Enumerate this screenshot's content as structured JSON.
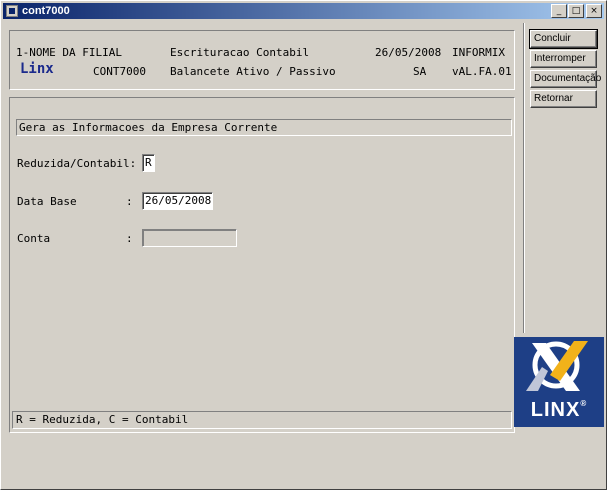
{
  "window": {
    "title": "cont7000"
  },
  "title_buttons": {
    "minimize": "_",
    "maximize": "□",
    "close": "×"
  },
  "header": {
    "row1": {
      "branch": "1-NOME DA FILIAL",
      "module": "Escrituracao Contabil",
      "date": "26/05/2008",
      "db": "INFORMIX"
    },
    "row2": {
      "logo": "Linx",
      "program": "CONT7000",
      "report": "Balancete Ativo / Passivo",
      "user": "SA",
      "version": "vAL.FA.01"
    }
  },
  "form": {
    "section_title": "Gera as Informacoes da Empresa Corrente",
    "fields": [
      {
        "label": "Reduzida/Contabil:",
        "value": "R"
      },
      {
        "label": "Data Base",
        "colon": ":",
        "value": "26/05/2008"
      },
      {
        "label": "Conta",
        "colon": ":",
        "value": ""
      }
    ],
    "status": "R = Reduzida, C = Contabil"
  },
  "side_buttons": [
    {
      "label": "Concluir"
    },
    {
      "label": "Interromper"
    },
    {
      "label": "Documentação"
    },
    {
      "label": "Retornar"
    }
  ],
  "brand": {
    "text": "LINX",
    "registered": "®",
    "colors": {
      "background": "#1e3f86",
      "accent": "#f2b21a"
    }
  }
}
